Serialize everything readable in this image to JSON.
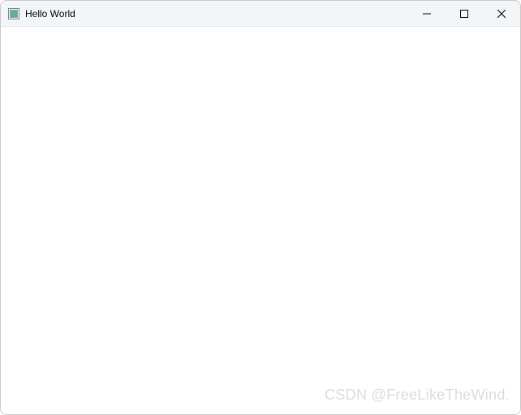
{
  "window": {
    "title": "Hello World"
  },
  "watermark": {
    "text": "CSDN @FreeLikeTheWind."
  }
}
